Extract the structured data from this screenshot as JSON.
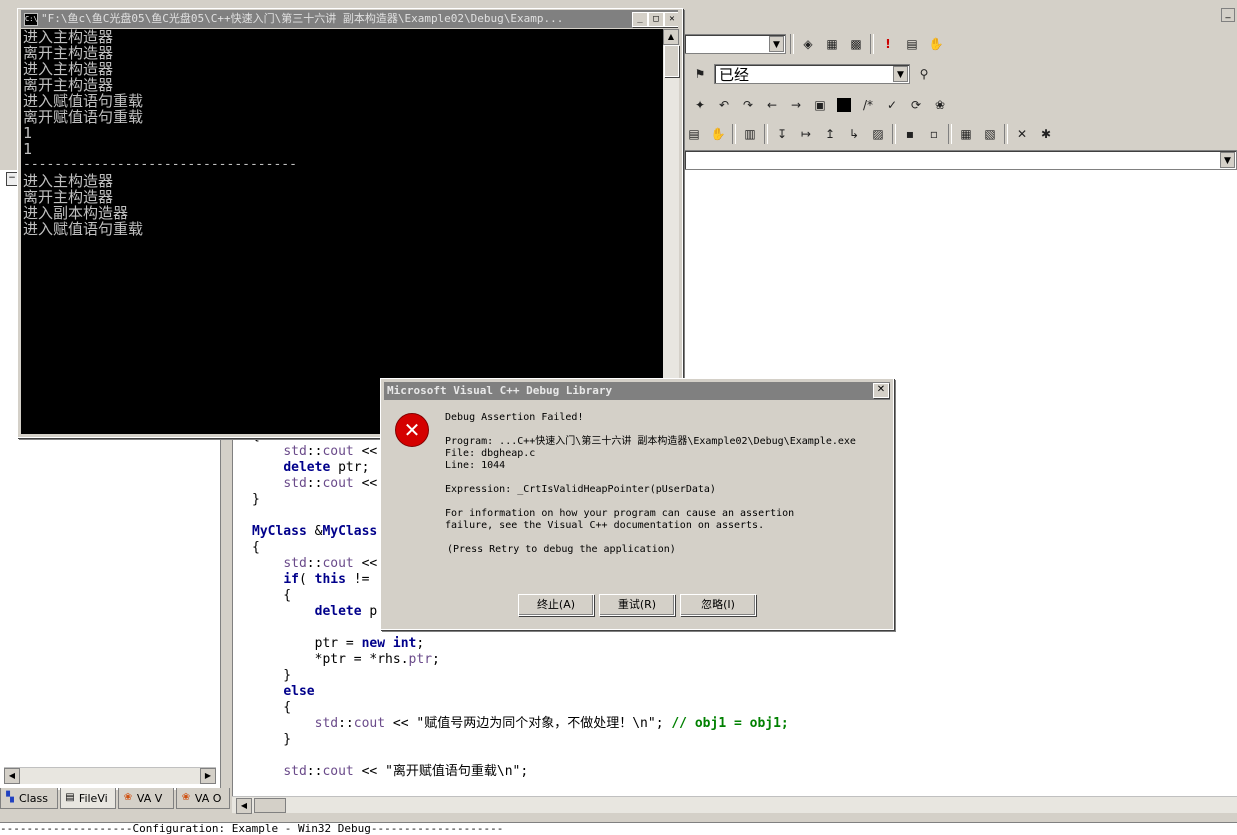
{
  "console": {
    "title": "\"F:\\鱼c\\鱼C光盘05\\鱼C光盘05\\C++快速入门\\第三十六讲 副本构造器\\Example02\\Debug\\Examp...",
    "lines": [
      "进入主构造器",
      "离开主构造器",
      "进入主构造器",
      "离开主构造器",
      "进入赋值语句重载",
      "离开赋值语句重载",
      "1",
      "1",
      "-----------------------------------",
      "进入主构造器",
      "离开主构造器",
      "进入副本构造器",
      "进入赋值语句重载"
    ],
    "minimize": "_",
    "maximize": "□",
    "close": "✕"
  },
  "toolbar": {
    "find_combo_value": "已经"
  },
  "dialog": {
    "title": "Microsoft Visual C++ Debug Library",
    "close": "✕",
    "icon_glyph": "✕",
    "heading": "Debug Assertion Failed!",
    "program": "Program: ...C++快速入门\\第三十六讲 副本构造器\\Example02\\Debug\\Example.exe",
    "file": "File: dbgheap.c",
    "line": "Line: 1044",
    "expression": "Expression: _CrtIsValidHeapPointer(pUserData)",
    "info1": "For information on how your program can cause an assertion",
    "info2": "failure, see the Visual C++ documentation on asserts.",
    "retry_note": "(Press Retry to debug the application)",
    "buttons": {
      "abort": "终止(A)",
      "retry": "重试(R)",
      "ignore": "忽略(I)"
    }
  },
  "workspace_tabs": [
    {
      "label": "Class",
      "icon": "class-view-icon"
    },
    {
      "label": "FileVi",
      "icon": "file-view-icon"
    },
    {
      "label": "VA V",
      "icon": "visual-assist-icon"
    },
    {
      "label": "VA O",
      "icon": "visual-assist-icon"
    }
  ],
  "output": {
    "text": "--------------------Configuration: Example - Win32 Debug--------------------"
  }
}
